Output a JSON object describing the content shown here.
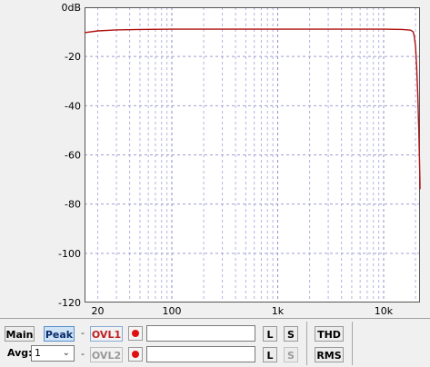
{
  "chart_data": {
    "type": "line",
    "title": "",
    "xlabel": "",
    "ylabel": "",
    "x_scale": "log",
    "xlim": [
      15,
      22050
    ],
    "ylim": [
      -120,
      0
    ],
    "y_ticks": [
      {
        "value": 0,
        "label": "0dB"
      },
      {
        "value": -20,
        "label": "-20"
      },
      {
        "value": -40,
        "label": "-40"
      },
      {
        "value": -60,
        "label": "-60"
      },
      {
        "value": -80,
        "label": "-80"
      },
      {
        "value": -100,
        "label": "-100"
      },
      {
        "value": -120,
        "label": "-120"
      }
    ],
    "x_ticks": [
      {
        "value": 20,
        "label": "20"
      },
      {
        "value": 100,
        "label": "100"
      },
      {
        "value": 1000,
        "label": "1k"
      },
      {
        "value": 10000,
        "label": "10k"
      }
    ],
    "grid": true,
    "line_color": "#b01010",
    "series": [
      {
        "x": [
          15,
          20,
          30,
          50,
          100,
          300,
          1000,
          3000,
          10000,
          15000,
          18000,
          19000,
          19500,
          20000,
          20500,
          21000,
          21500,
          22000,
          22050
        ],
        "values": [
          -10.3,
          -9.6,
          -9.2,
          -9.0,
          -8.9,
          -8.9,
          -8.9,
          -8.9,
          -8.9,
          -9.0,
          -9.3,
          -10.0,
          -12.0,
          -16.0,
          -24.0,
          -35.0,
          -50.0,
          -70.0,
          -74.0
        ]
      }
    ],
    "noise_floor": {
      "x_start": 22000,
      "x_end": 22050,
      "min": -79,
      "max": -57
    }
  },
  "panel": {
    "main_label": "Main",
    "peak_label": "Peak",
    "ovl1_label": "OVL1",
    "ovl2_label": "OVL2",
    "avg_label": "Avg:",
    "avg_value": "1",
    "dash": "-",
    "l_label": "L",
    "s_label": "S",
    "thd_label": "THD",
    "rms_label": "RMS",
    "led_color": "#e01010"
  }
}
